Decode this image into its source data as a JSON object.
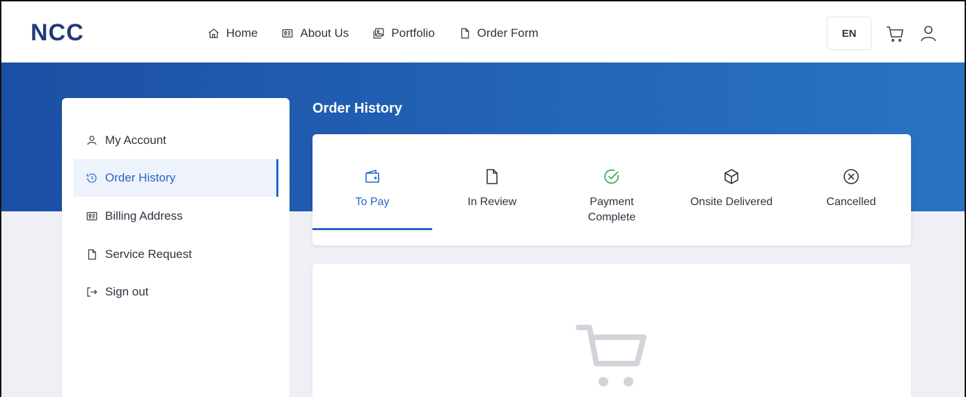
{
  "header": {
    "logo": "NCC",
    "nav": [
      {
        "label": "Home",
        "icon": "home-icon"
      },
      {
        "label": "About Us",
        "icon": "id-card-icon"
      },
      {
        "label": "Portfolio",
        "icon": "image-icon"
      },
      {
        "label": "Order Form",
        "icon": "file-icon"
      }
    ],
    "lang": "EN",
    "cart_icon": "cart-icon",
    "user_icon": "user-icon"
  },
  "sidebar": {
    "items": [
      {
        "label": "My Account",
        "icon": "user-icon",
        "active": false
      },
      {
        "label": "Order History",
        "icon": "history-icon",
        "active": true
      },
      {
        "label": "Billing Address",
        "icon": "id-card-icon",
        "active": false
      },
      {
        "label": "Service Request",
        "icon": "file-icon",
        "active": false
      },
      {
        "label": "Sign out",
        "icon": "sign-out-icon",
        "active": false
      }
    ]
  },
  "main": {
    "title": "Order History",
    "tabs": [
      {
        "label": "To Pay",
        "icon": "wallet-icon",
        "active": true
      },
      {
        "label": "In Review",
        "icon": "file-icon",
        "active": false
      },
      {
        "label": "Payment Complete",
        "icon": "check-circle-icon",
        "active": false
      },
      {
        "label": "Onsite Delivered",
        "icon": "box-icon",
        "active": false
      },
      {
        "label": "Cancelled",
        "icon": "x-circle-icon",
        "active": false
      }
    ],
    "empty_state_icon": "empty-cart-icon"
  },
  "colors": {
    "brand": "#233a7a",
    "accent": "#2564c8",
    "success": "#2aa84a",
    "banner_start": "#1c4fa3",
    "banner_end": "#2a72c2"
  }
}
